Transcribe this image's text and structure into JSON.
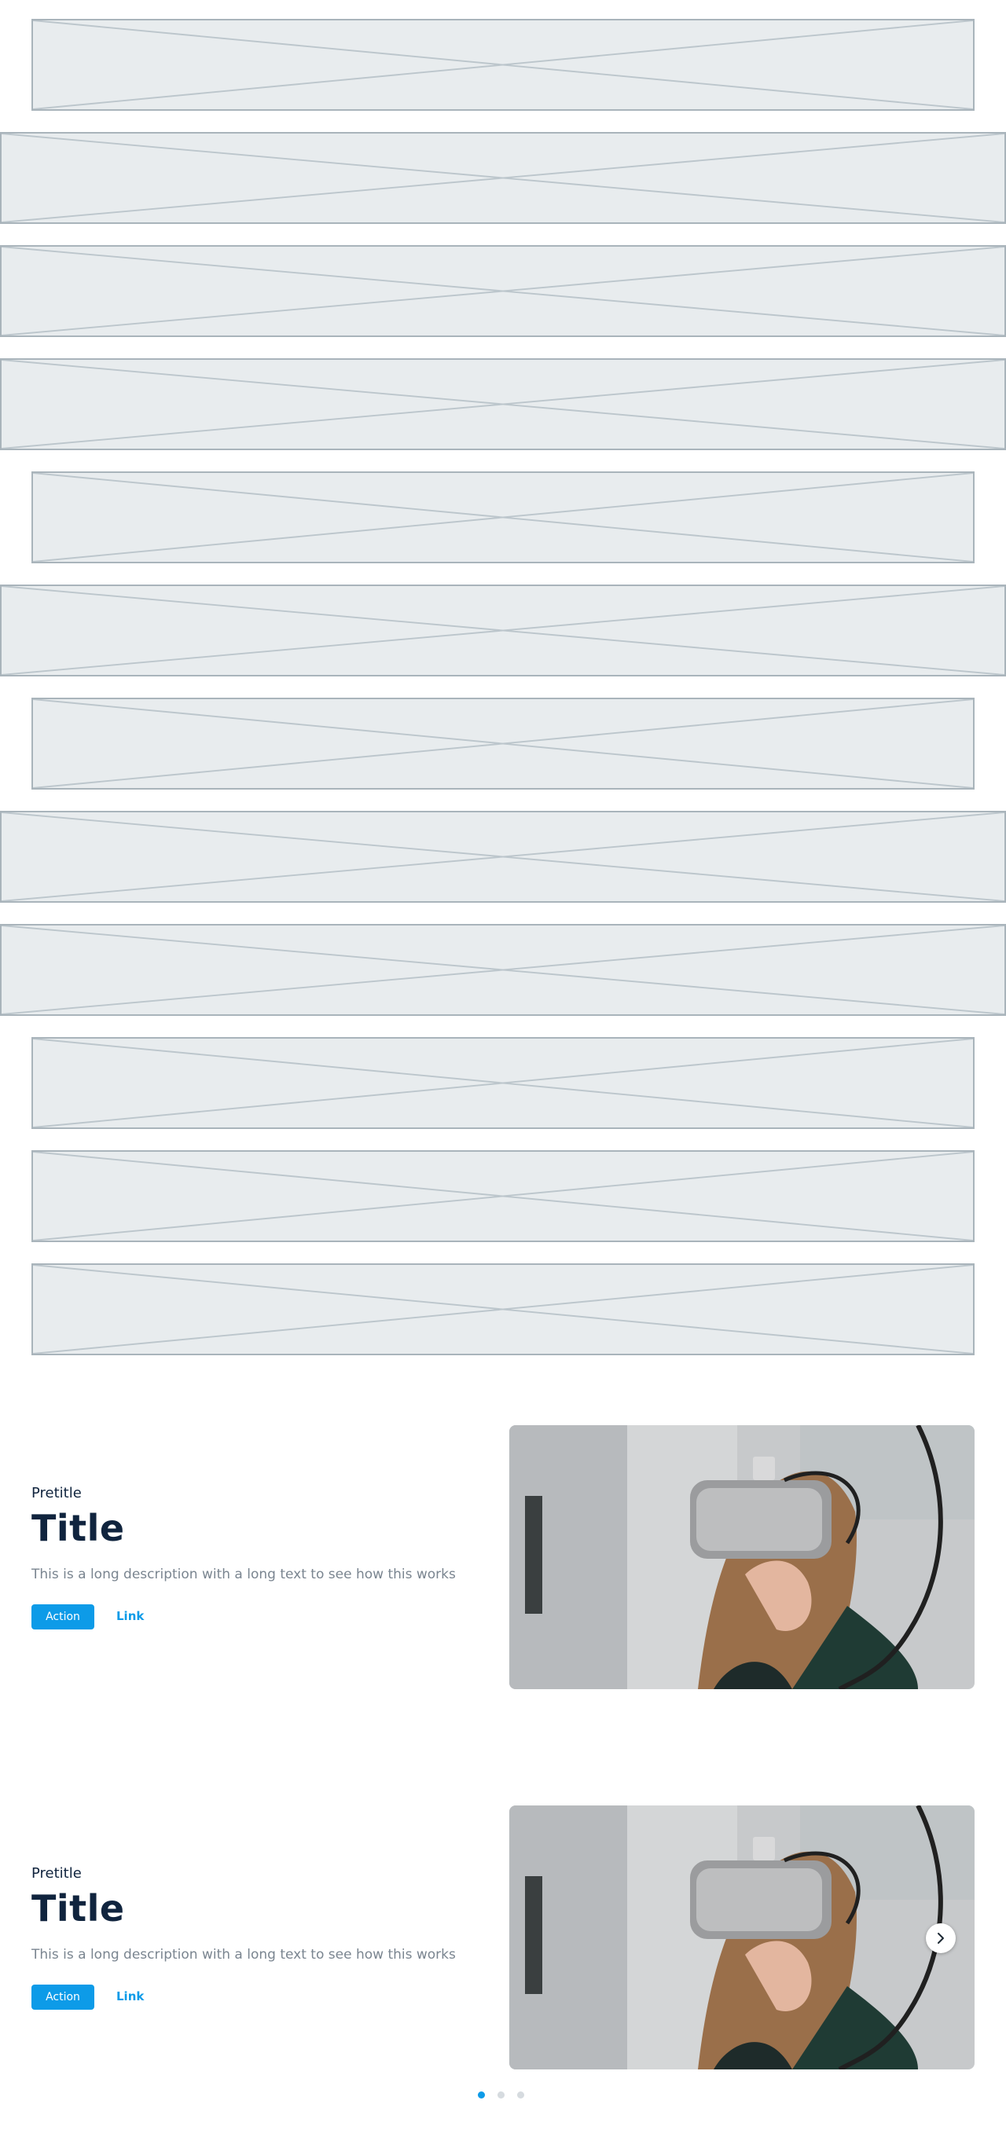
{
  "placeholders": [
    {
      "variant": "narrow"
    },
    {
      "variant": "wide"
    },
    {
      "variant": "wide"
    },
    {
      "variant": "wide"
    },
    {
      "variant": "narrow"
    },
    {
      "variant": "wide"
    },
    {
      "variant": "narrow"
    },
    {
      "variant": "wide"
    },
    {
      "variant": "wide"
    },
    {
      "variant": "narrow"
    },
    {
      "variant": "narrow"
    },
    {
      "variant": "narrow"
    }
  ],
  "heroes": [
    {
      "pretitle": "Pretitle",
      "title": "Title",
      "description": "This is a long description with a long text to see how this works",
      "action_label": "Action",
      "link_label": "Link"
    },
    {
      "pretitle": "Pretitle",
      "title": "Title",
      "description": "This is a long description with a long text to see how this works",
      "action_label": "Action",
      "link_label": "Link"
    }
  ],
  "carousel": {
    "next_icon": "chevron-right-icon",
    "page_count": 3,
    "active_page": 1
  },
  "colors": {
    "accent": "#0d9be8",
    "title": "#10243e",
    "description": "#7a8590",
    "placeholder_fill": "#e8ecee",
    "placeholder_border": "#a9b4bb"
  }
}
